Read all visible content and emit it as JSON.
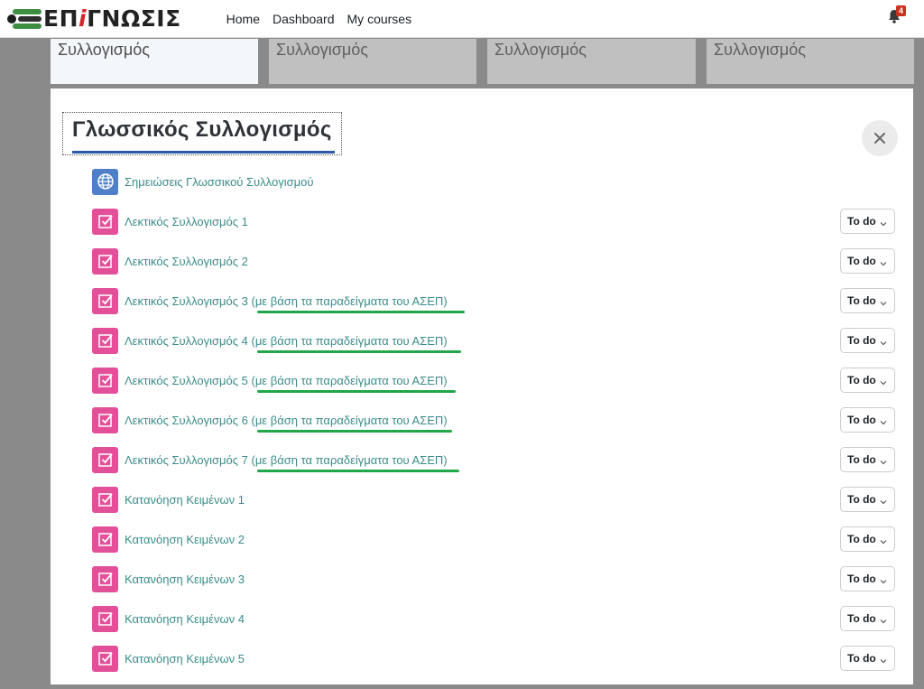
{
  "brand": {
    "prefix": "ΕΠ",
    "accent": "i",
    "suffix": "ΓΝΩΣΙΣ"
  },
  "nav": [
    {
      "label": "Home"
    },
    {
      "label": "Dashboard"
    },
    {
      "label": "My courses"
    }
  ],
  "notifications": {
    "count": "4"
  },
  "tiles": [
    {
      "label": "Συλλογισμός"
    },
    {
      "label": "Συλλογισμός"
    },
    {
      "label": "Συλλογισμός"
    },
    {
      "label": "Συλλογισμός"
    }
  ],
  "modal": {
    "title": "Γλωσσικός Συλλογισμός",
    "activities": [
      {
        "name": "Σημειώσεις Γλωσσικού Συλλογισμού",
        "suffix": "",
        "type": "page"
      },
      {
        "name": "Λεκτικός Συλλογισμός 1",
        "suffix": "",
        "type": "quiz",
        "status": "To do"
      },
      {
        "name": "Λεκτικός Συλλογισμός 2",
        "suffix": "",
        "type": "quiz",
        "status": "To do"
      },
      {
        "name": "Λεκτικός Συλλογισμός 3",
        "suffix": " (με βάση τα παραδείγματα του ΑΣΕΠ)",
        "type": "quiz",
        "status": "To do"
      },
      {
        "name": "Λεκτικός Συλλογισμός 4",
        "suffix": " (με βάση τα παραδείγματα του ΑΣΕΠ)",
        "type": "quiz",
        "status": "To do"
      },
      {
        "name": "Λεκτικός Συλλογισμός 5",
        "suffix": " (με βάση τα παραδείγματα του ΑΣΕΠ)",
        "type": "quiz",
        "status": "To do"
      },
      {
        "name": "Λεκτικός Συλλογισμός 6",
        "suffix": " (με βάση τα παραδείγματα του ΑΣΕΠ)",
        "type": "quiz",
        "status": "To do"
      },
      {
        "name": "Λεκτικός Συλλογισμός 7",
        "suffix": " (με βάση τα παραδείγματα του ΑΣΕΠ)",
        "type": "quiz",
        "status": "To do"
      },
      {
        "name": "Κατανόηση Κειμένων 1",
        "suffix": "",
        "type": "quiz",
        "status": "To do"
      },
      {
        "name": "Κατανόηση Κειμένων 2",
        "suffix": "",
        "type": "quiz",
        "status": "To do"
      },
      {
        "name": "Κατανόηση Κειμένων 3",
        "suffix": "",
        "type": "quiz",
        "status": "To do"
      },
      {
        "name": "Κατανόηση Κειμένων 4",
        "suffix": "",
        "type": "quiz",
        "status": "To do"
      },
      {
        "name": "Κατανόηση Κειμένων 5",
        "suffix": "",
        "type": "quiz",
        "status": "To do"
      }
    ]
  },
  "colors": {
    "accent_link": "#3b8b8b",
    "quiz_icon": "#e2509a",
    "page_icon": "#4f7fc9",
    "highlight": "#21a64a"
  }
}
